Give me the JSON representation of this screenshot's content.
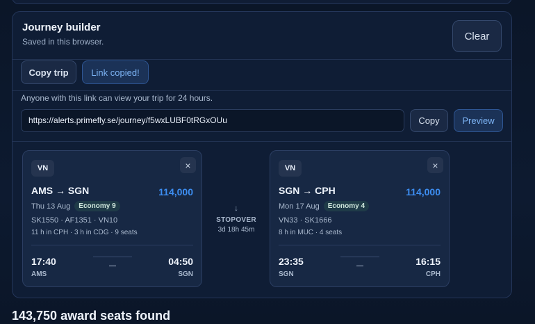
{
  "builder": {
    "title": "Journey builder",
    "subtitle": "Saved in this browser.",
    "clear_label": "Clear",
    "copy_trip_label": "Copy trip",
    "link_copied_label": "Link copied!"
  },
  "share": {
    "note": "Anyone with this link can view your trip for 24 hours.",
    "url": "https://alerts.primefly.se/journey/f5wxLUBF0tRGxOUu",
    "copy_label": "Copy",
    "preview_label": "Preview"
  },
  "legs": [
    {
      "carrier": "VN",
      "route": "AMS → SGN",
      "price": "114,000",
      "date": "Thu 13 Aug",
      "cabin": "Economy 9",
      "flights": "SK1550 · AF1351 · VN10",
      "detail": "11 h in CPH · 3 h in CDG · 9 seats",
      "dep_time": "17:40",
      "dep_code": "AMS",
      "arr_time": "04:50",
      "arr_code": "SGN"
    },
    {
      "carrier": "VN",
      "route": "SGN → CPH",
      "price": "114,000",
      "date": "Mon 17 Aug",
      "cabin": "Economy 4",
      "flights": "VN33 · SK1666",
      "detail": "8 h in MUC · 4 seats",
      "dep_time": "23:35",
      "dep_code": "SGN",
      "arr_time": "16:15",
      "arr_code": "CPH"
    }
  ],
  "stopover": {
    "arrow": "↓",
    "label": "STOPOVER",
    "duration": "3d 18h 45m"
  },
  "results": {
    "summary": "143,750 award seats found"
  },
  "icons": {
    "close": "×"
  },
  "colors": {
    "accent": "#3d8ef2",
    "background": "#0b1628",
    "panel": "#0f1d35",
    "card": "#172844"
  }
}
